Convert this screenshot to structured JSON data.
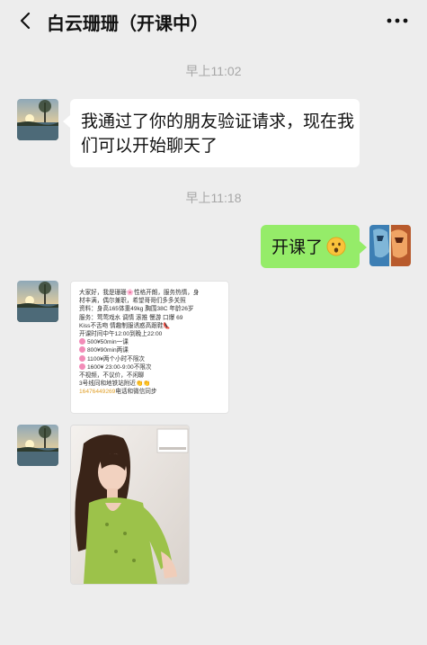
{
  "header": {
    "title": "白云珊珊（开课中）",
    "back_icon": "chevron-left-icon",
    "more_icon": "more-dots-icon"
  },
  "timestamps": [
    "早上11:02",
    "早上11:18"
  ],
  "messages": {
    "system_friend": "我通过了你的朋友验证请求，现在我们可以开始聊天了",
    "me_text": "开课了",
    "me_emoji": "hushed-face-emoji",
    "ad_card": {
      "lines": [
        "大家好，我是珊珊🌸性格开朗，服务热情，身",
        "材丰满，偶尔兼职，希望哥哥们多多关照",
        "资料：身高165体重49kg 胸围38C 年龄26岁",
        "服务：莺莺戏水 调情 滚推 慢游 口爆 69",
        "Kiss不舌吻 情趣制服诱惑高跟鞋👠",
        "开课时间中午12:00到晚上22:00"
      ],
      "price_lines": [
        "500¥50min一课",
        "800¥90min两课",
        "1100¥两个小时不限次",
        "1600¥ 23:00-9:00不限次"
      ],
      "tail_lines": [
        "不视频，不议价，不闲聊",
        "3号线同和地铁站附近👏👏"
      ],
      "phone": "16476449269",
      "phone_suffix": "电话和微信同步"
    }
  },
  "colors": {
    "background": "#ededed",
    "my_bubble": "#95ec69",
    "their_bubble": "#ffffff",
    "timestamp": "#a7a7a7",
    "phone_link": "#e0a02b"
  }
}
